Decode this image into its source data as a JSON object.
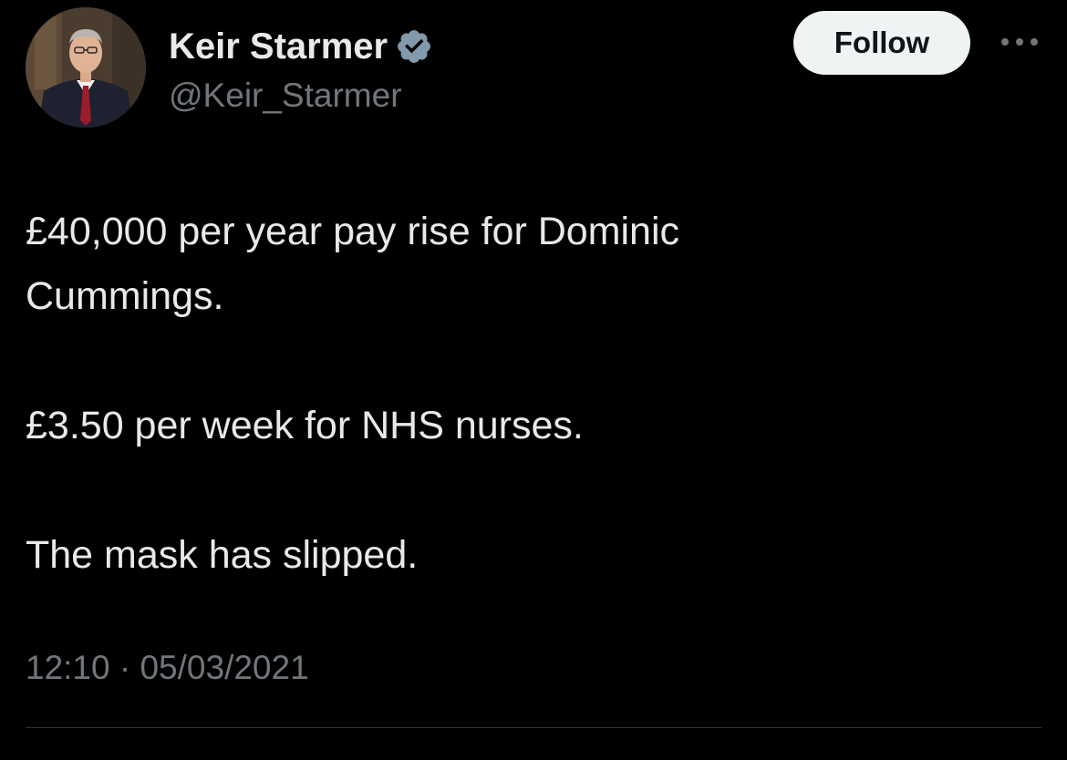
{
  "author": {
    "display_name": "Keir Starmer",
    "handle": "@Keir_Starmer",
    "verified": true,
    "avatar_icon": "profile-photo"
  },
  "actions": {
    "follow_label": "Follow",
    "more_icon": "more-dots-icon"
  },
  "tweet": {
    "lines": [
      "£40,000 per year pay rise for Dominic",
      "Cummings.",
      "£3.50 per week for NHS nurses.",
      "The mask has slipped."
    ],
    "time": "12:10",
    "separator": "·",
    "date": "05/03/2021"
  },
  "colors": {
    "background": "#000000",
    "primary_text": "#e7e9ea",
    "secondary_text": "#71767b",
    "verified_badge": "#829aab",
    "follow_bg": "#eff3f4",
    "follow_text": "#0f1419",
    "divider": "#2f3336"
  }
}
